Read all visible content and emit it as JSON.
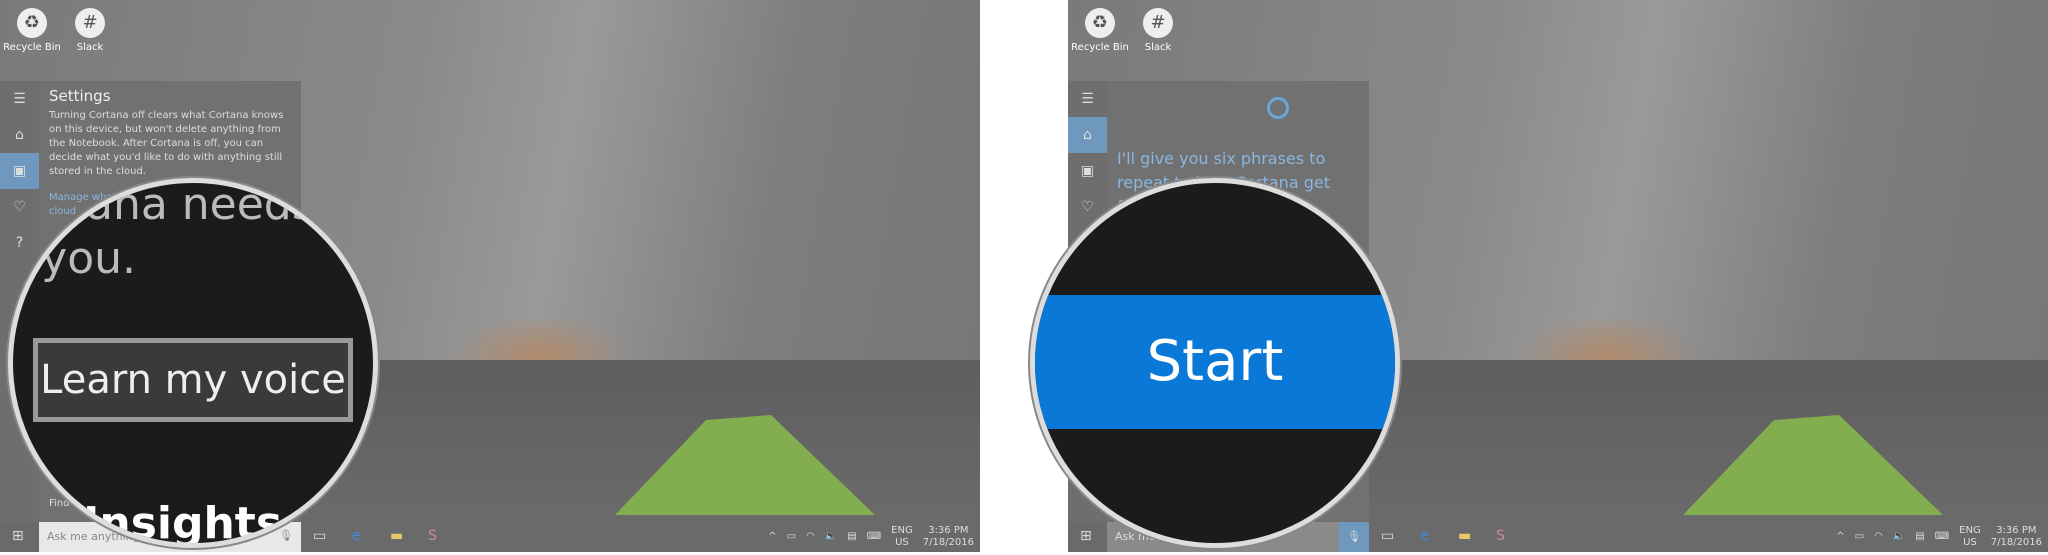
{
  "desktop": {
    "icons": [
      {
        "label": "Recycle Bin",
        "icon": "recycle-bin-icon"
      },
      {
        "label": "Slack",
        "icon": "slack-icon"
      }
    ]
  },
  "left": {
    "pane_title": "Settings",
    "pane_text": "Turning Cortana off clears what Cortana knows on this device, but won't delete anything from the Notebook. After Cortana is off, you can decide what you'd like to do with anything still stored in the cloud.",
    "pane_link": "Manage what Cortana knows about me in the cloud",
    "pane_find": "Find",
    "magnified_line1": "Cortana needs to",
    "magnified_line2": "to you.",
    "button": "Learn my voice",
    "magnified_bottom": "Insights and m"
  },
  "right": {
    "prompt": "I'll give you six phrases to repeat to help Cortana get familiar",
    "button": "Start"
  },
  "taskbar": {
    "search_placeholder": "Ask me anything",
    "lang1": "ENG",
    "lang2": "US",
    "time": "3:36 PM",
    "date": "7/18/2016"
  }
}
